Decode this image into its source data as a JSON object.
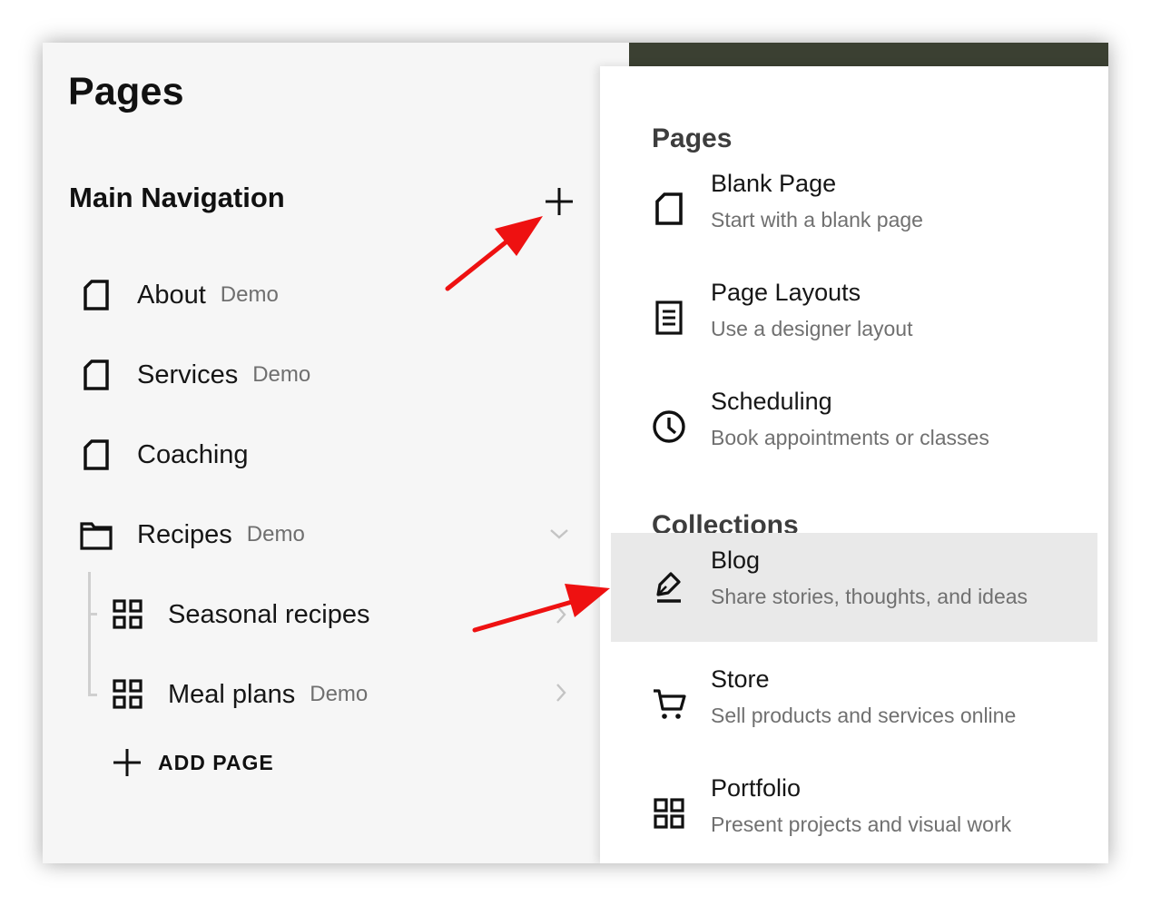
{
  "sidebar": {
    "title": "Pages",
    "section_title": "Main Navigation",
    "items": [
      {
        "label": "About",
        "tag": "Demo",
        "icon": "page-icon"
      },
      {
        "label": "Services",
        "tag": "Demo",
        "icon": "page-icon"
      },
      {
        "label": "Coaching",
        "tag": "",
        "icon": "page-icon"
      },
      {
        "label": "Recipes",
        "tag": "Demo",
        "icon": "folder-icon"
      },
      {
        "label": "Seasonal recipes",
        "tag": "",
        "icon": "grid-icon"
      },
      {
        "label": "Meal plans",
        "tag": "Demo",
        "icon": "grid-icon"
      }
    ],
    "add_page_label": "ADD PAGE"
  },
  "panel": {
    "pages_title": "Pages",
    "pages": [
      {
        "name": "Blank Page",
        "description": "Start with a blank page",
        "icon": "blank-page-icon"
      },
      {
        "name": "Page Layouts",
        "description": "Use a designer layout",
        "icon": "layout-icon"
      },
      {
        "name": "Scheduling",
        "description": "Book appointments or classes",
        "icon": "clock-icon"
      }
    ],
    "collections_title": "Collections",
    "collections": [
      {
        "name": "Blog",
        "description": "Share stories, thoughts, and ideas",
        "icon": "pen-icon",
        "highlighted": true
      },
      {
        "name": "Store",
        "description": "Sell products and services online",
        "icon": "cart-icon"
      },
      {
        "name": "Portfolio",
        "description": "Present projects and visual work",
        "icon": "grid-icon"
      }
    ]
  },
  "colors": {
    "topbar": "#3b4032",
    "sidebar_bg": "#f6f6f6",
    "highlight": "#e9e9e9",
    "annotation_arrow": "#ee1111",
    "muted_text": "#6f6f6f"
  }
}
